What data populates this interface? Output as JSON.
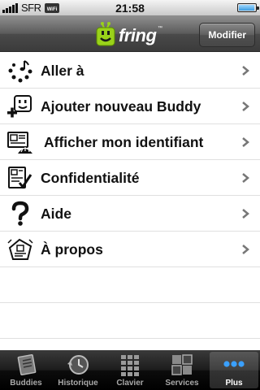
{
  "status_bar": {
    "carrier": "SFR",
    "wifi_label": "WiFi",
    "time": "21:58",
    "battery_level": 0.95
  },
  "nav_bar": {
    "logo_text": "fring",
    "logo_tm": "™",
    "edit_button": "Modifier"
  },
  "menu": {
    "items": [
      {
        "label": "Aller à",
        "icon": "dots-music-icon"
      },
      {
        "label": "Ajouter nouveau Buddy",
        "icon": "add-buddy-icon"
      },
      {
        "label": "Afficher mon identifiant",
        "icon": "id-card-icon"
      },
      {
        "label": "Confidentialité",
        "icon": "privacy-checklist-icon"
      },
      {
        "label": "Aide",
        "icon": "question-mark-icon"
      },
      {
        "label": "À propos",
        "icon": "about-icon"
      }
    ],
    "chevron_icon": "chevron-right-icon"
  },
  "tab_bar": {
    "tabs": [
      {
        "label": "Buddies",
        "icon": "buddies-icon",
        "active": false
      },
      {
        "label": "Historique",
        "icon": "history-clock-icon",
        "active": false
      },
      {
        "label": "Clavier",
        "icon": "keypad-icon",
        "active": false
      },
      {
        "label": "Services",
        "icon": "services-icon",
        "active": false
      },
      {
        "label": "Plus",
        "icon": "more-dots-icon",
        "active": true
      }
    ]
  },
  "colors": {
    "logo_green": "#9ad21a",
    "text": "#111111",
    "tab_inactive": "#a8a8a8",
    "tab_active": "#ffffff"
  }
}
